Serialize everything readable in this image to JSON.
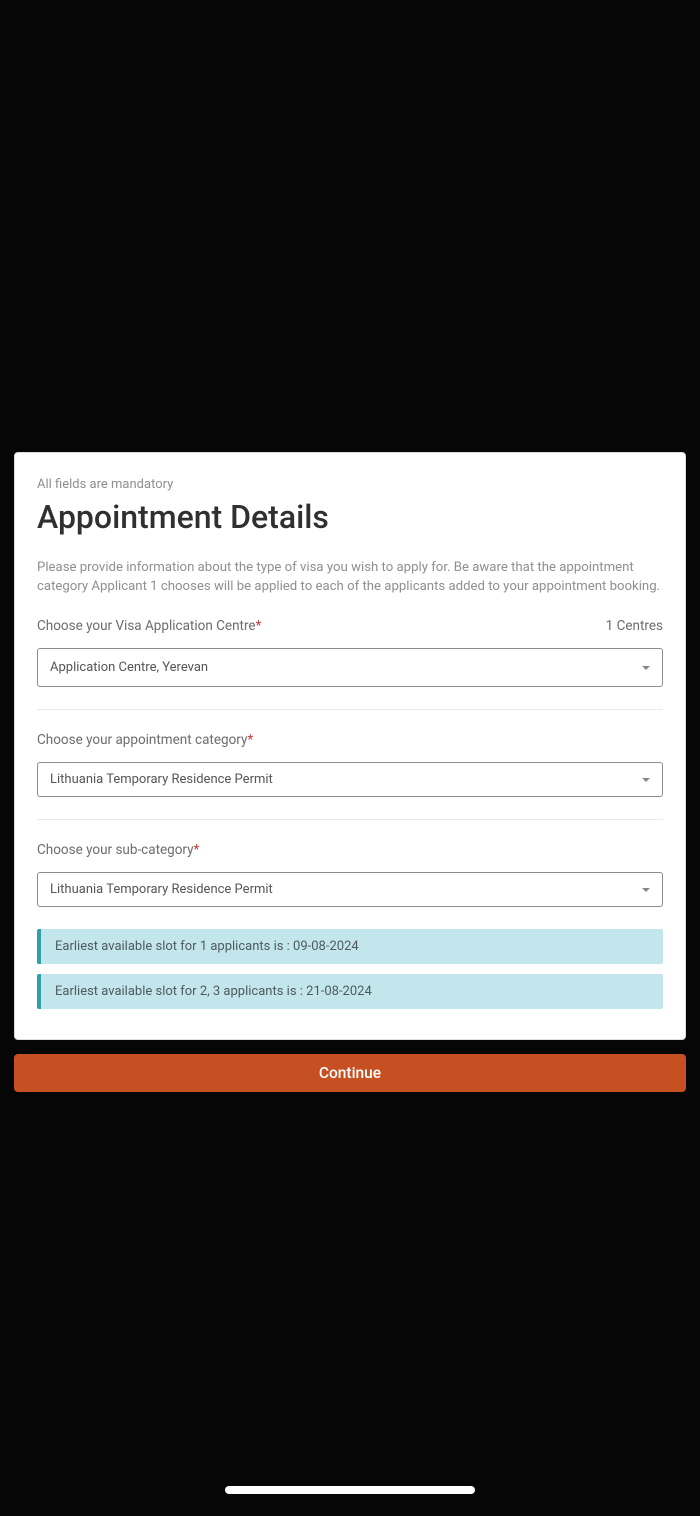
{
  "header": {
    "mandatory_note": "All fields are mandatory",
    "title": "Appointment Details",
    "intro": "Please provide information about the type of visa you wish to apply for. Be aware that the appointment category Applicant 1 chooses will be applied to each of the applicants added to your appointment booking."
  },
  "fields": {
    "centre": {
      "label": "Choose your Visa Application Centre",
      "count_label": "1 Centres",
      "value": "Application Centre, Yerevan"
    },
    "category": {
      "label": "Choose your appointment category",
      "value": "Lithuania Temporary Residence Permit"
    },
    "subcategory": {
      "label": "Choose your sub-category",
      "value": "Lithuania Temporary Residence Permit"
    }
  },
  "slots": {
    "slot1": "Earliest available slot for 1 applicants is : 09-08-2024",
    "slot2": "Earliest available slot for 2, 3 applicants is : 21-08-2024"
  },
  "actions": {
    "continue": "Continue"
  },
  "required_mark": "*"
}
